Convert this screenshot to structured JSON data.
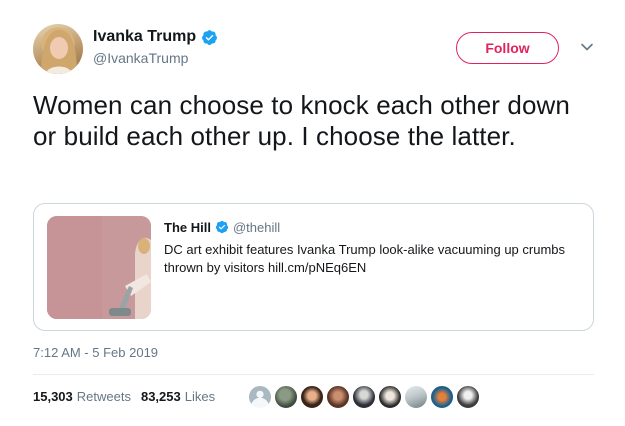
{
  "author": {
    "name": "Ivanka Trump",
    "handle": "@IvankaTrump",
    "verified_icon": "verified-badge-icon"
  },
  "follow_button": {
    "label": "Follow"
  },
  "tweet": {
    "text": "Women can choose to knock each other down or build each other up. I choose the latter.",
    "timestamp": "7:12 AM - 5 Feb 2019"
  },
  "quote": {
    "name": "The Hill",
    "handle": "@thehill",
    "text": "DC art exhibit features Ivanka Trump look-alike vacuuming up crumbs thrown by visitors hill.cm/pNEq6EN"
  },
  "stats": {
    "retweets_count": "15,303",
    "retweets_label": "Retweets",
    "likes_count": "83,253",
    "likes_label": "Likes"
  },
  "colors": {
    "follow_accent": "#e0245e",
    "verified_blue": "#1da1f2",
    "secondary_text": "#657786",
    "border": "#ccd6dd"
  },
  "likers": [
    "liker-avatar-1",
    "liker-avatar-2",
    "liker-avatar-3",
    "liker-avatar-4",
    "liker-avatar-5",
    "liker-avatar-6",
    "liker-avatar-7",
    "liker-avatar-8",
    "liker-avatar-9"
  ]
}
